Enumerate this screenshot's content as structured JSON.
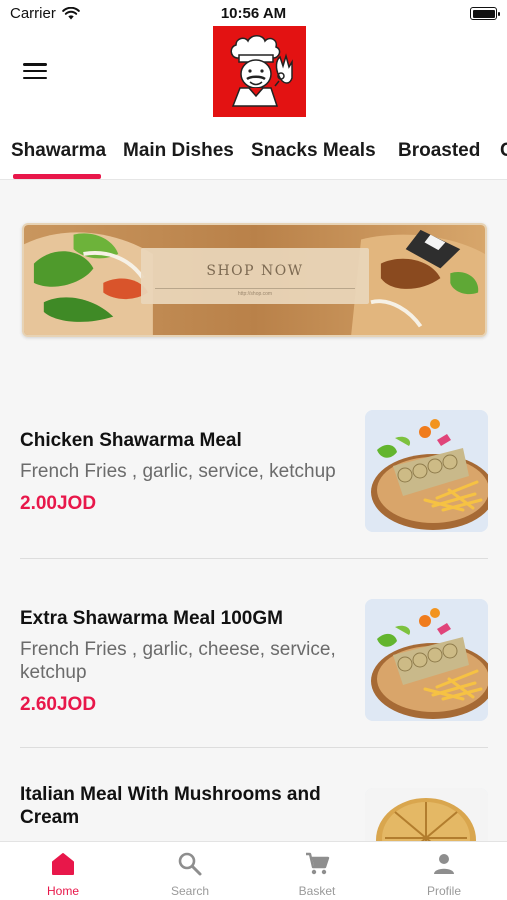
{
  "status_bar": {
    "carrier": "Carrier",
    "time": "10:56 AM"
  },
  "header": {
    "menu_icon": "hamburger-icon",
    "logo": "chef-logo"
  },
  "tabs": [
    {
      "label": "Shawarma",
      "active": true
    },
    {
      "label": "Main Dishes"
    },
    {
      "label": "Snacks Meals"
    },
    {
      "label": "Broasted"
    },
    {
      "label": "C"
    }
  ],
  "banner": {
    "cta": "SHOP NOW",
    "url": "http://shop.com"
  },
  "items": [
    {
      "name": "Chicken Shawarma Meal",
      "description": "French Fries , garlic, service, ketchup",
      "price": "2.00JOD"
    },
    {
      "name": "Extra Shawarma Meal 100GM",
      "description": "French Fries , garlic, cheese, service, ketchup",
      "price": "2.60JOD"
    },
    {
      "name": "Italian Meal With Mushrooms and Cream",
      "description": "",
      "price": ""
    }
  ],
  "bottom_nav": [
    {
      "label": "Home",
      "icon": "home-icon",
      "active": true
    },
    {
      "label": "Search",
      "icon": "search-icon"
    },
    {
      "label": "Basket",
      "icon": "cart-icon"
    },
    {
      "label": "Profile",
      "icon": "profile-icon"
    }
  ],
  "colors": {
    "accent": "#e8174a",
    "logo_bg": "#e31212",
    "inactive_nav": "#9a9a9a"
  }
}
